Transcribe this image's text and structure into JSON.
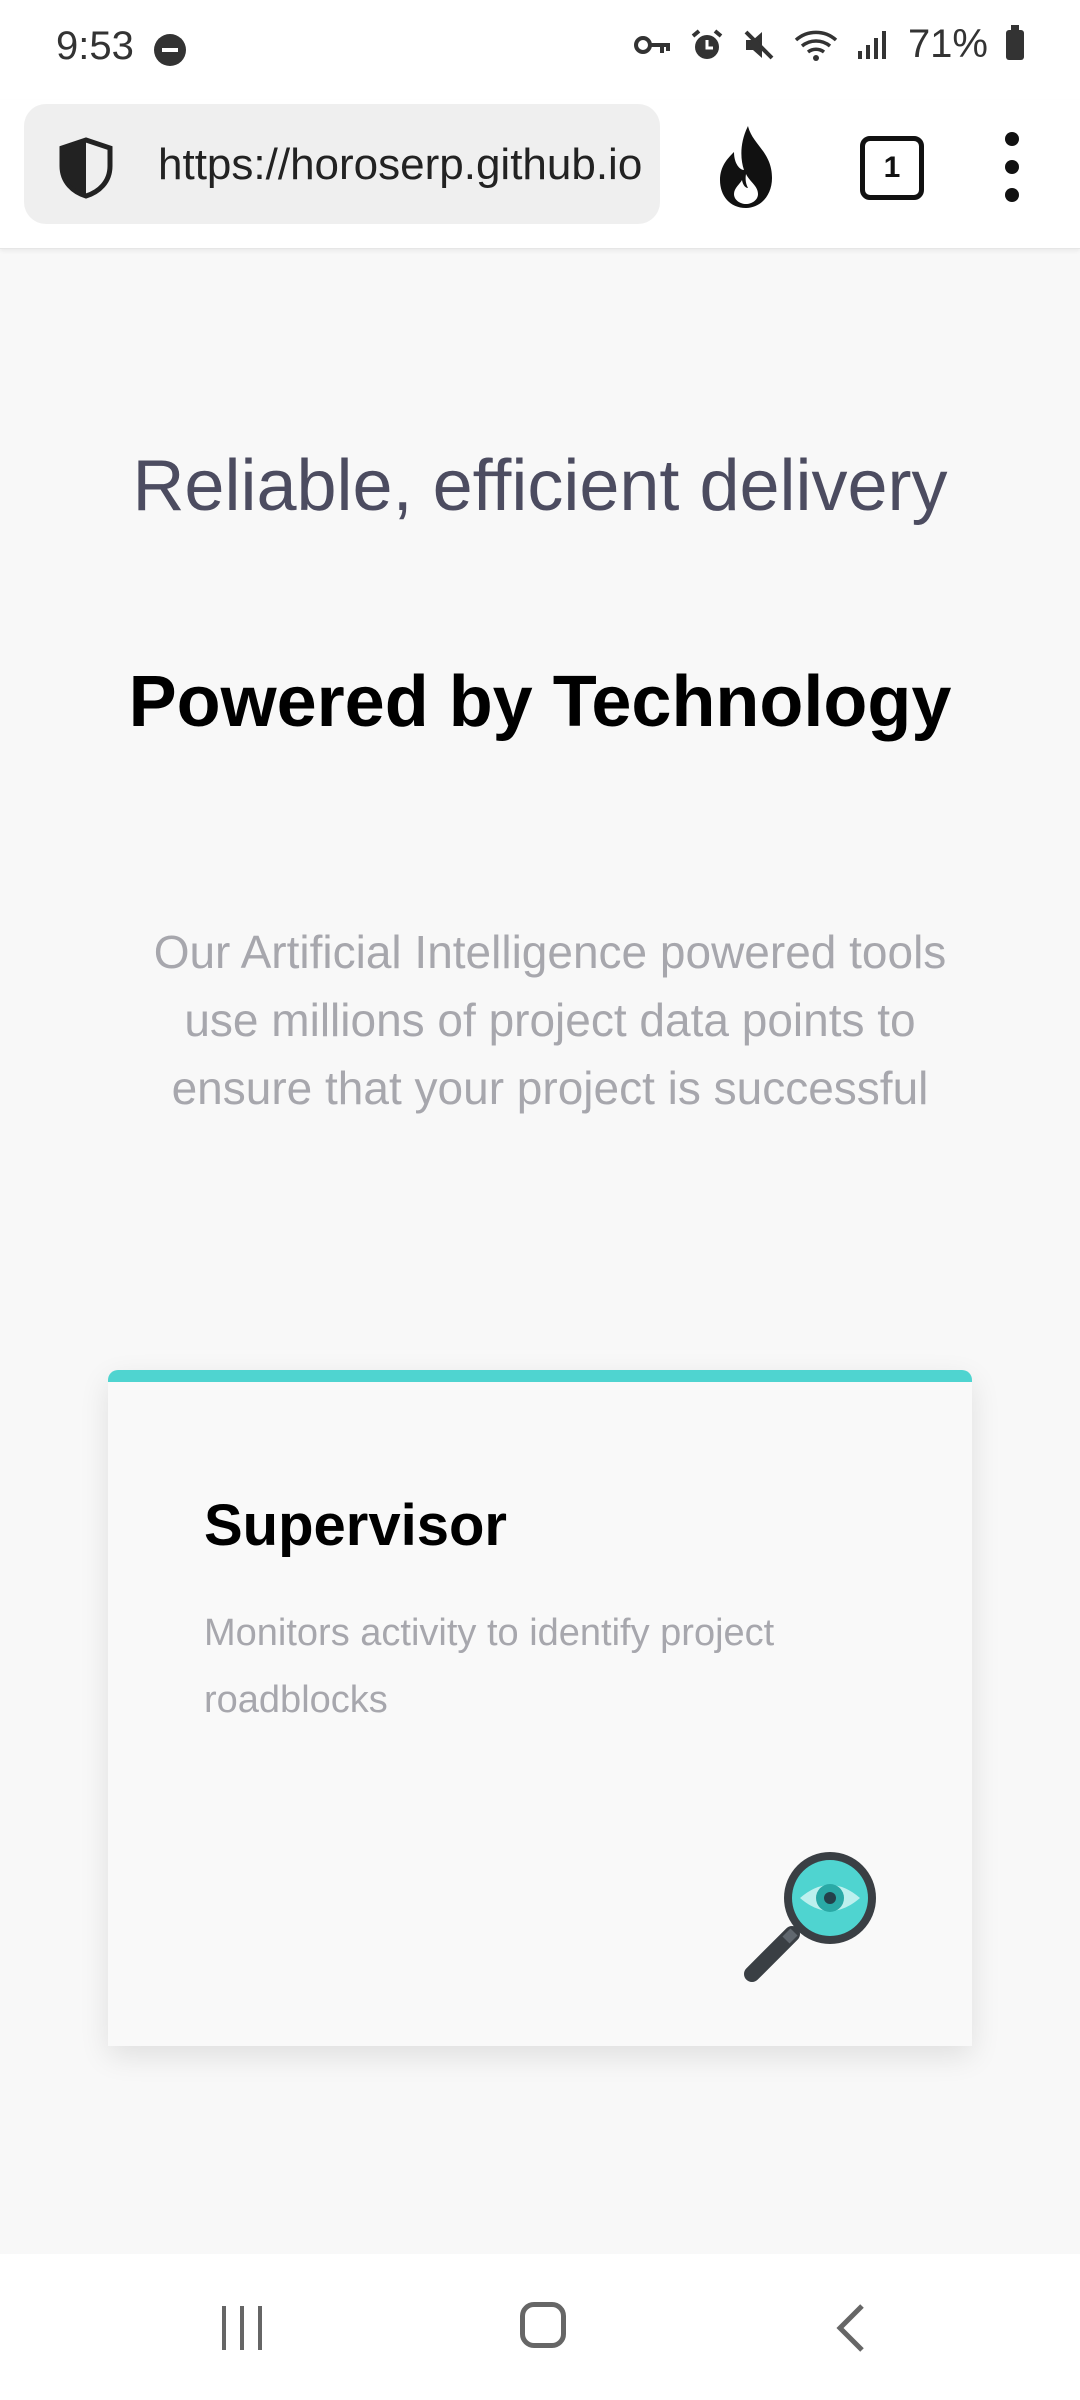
{
  "status_bar": {
    "time": "9:53",
    "battery": "71%",
    "icons": [
      "do-not-disturb-icon",
      "vpn-key-icon",
      "alarm-icon",
      "mute-icon",
      "wifi-icon",
      "signal-icon",
      "battery-icon"
    ]
  },
  "browser": {
    "url": "https://horoserp.github.io",
    "tab_count": "1"
  },
  "hero": {
    "title": "Reliable, efficient delivery",
    "subtitle": "Powered by Technology",
    "description": "Our Artificial Intelligence powered tools use millions of project data points to ensure that your project is successful"
  },
  "card": {
    "title": "Supervisor",
    "description": "Monitors activity to identify project roadblocks",
    "icon": "magnifier-eye-icon",
    "accent_color": "#4fd4d0"
  }
}
